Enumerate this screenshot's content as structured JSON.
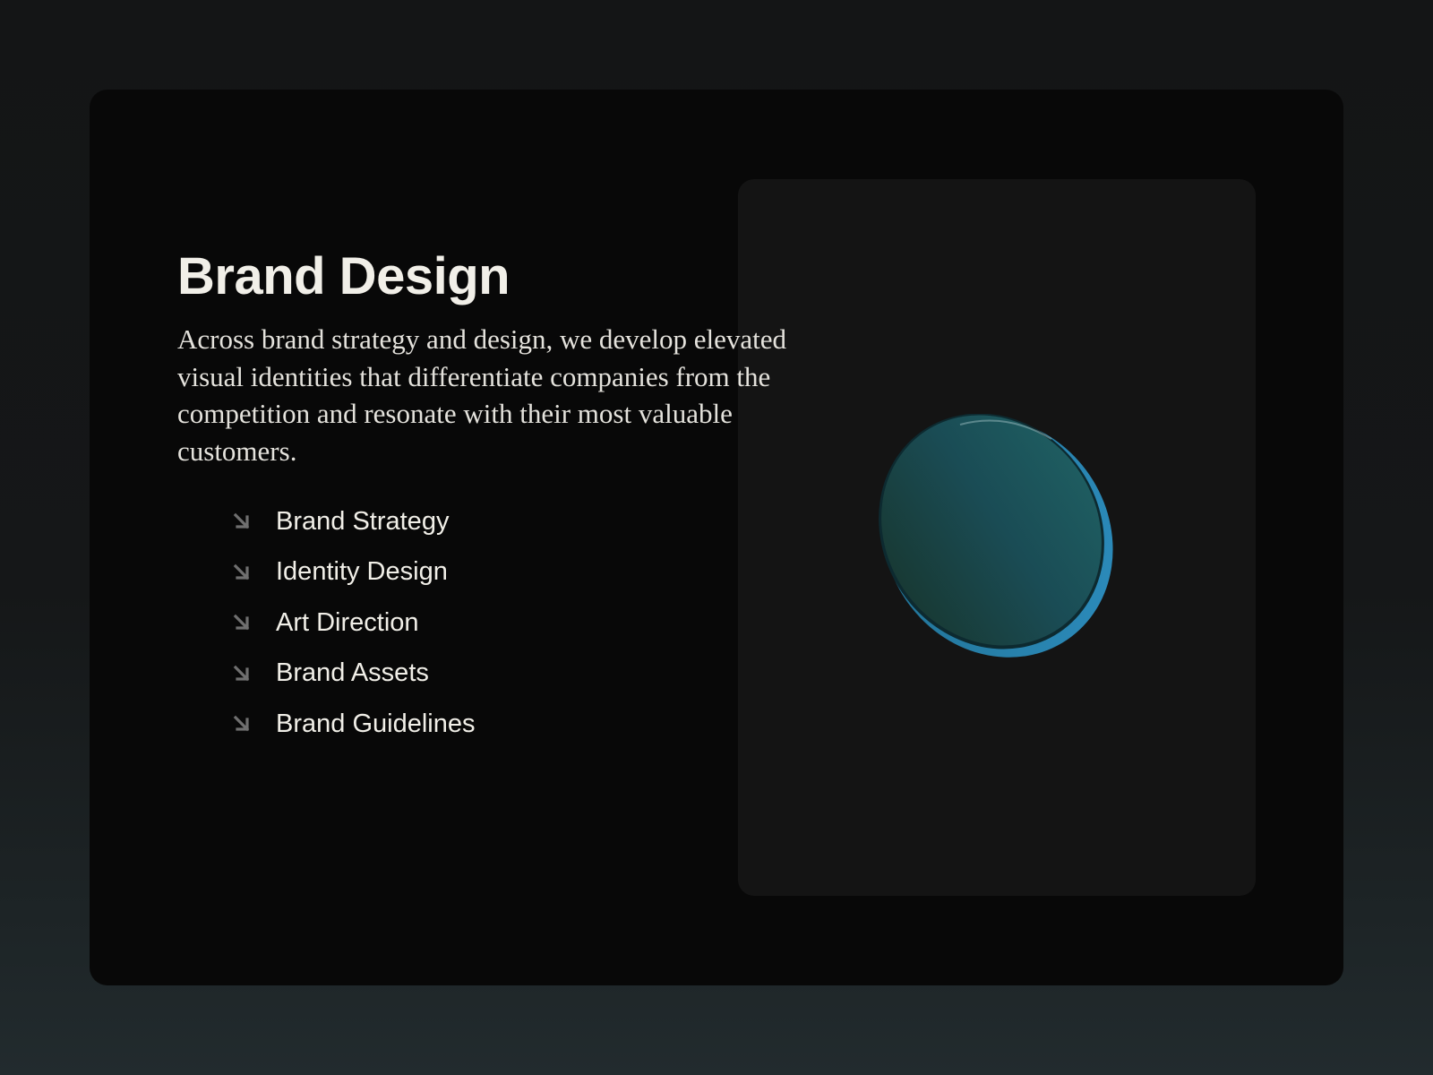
{
  "section": {
    "title": "Brand Design",
    "description": "Across brand strategy and design, we develop elevated visual identities that differentiate companies from the competition and resonate with their most valuable customers."
  },
  "services": [
    {
      "label": "Brand Strategy",
      "icon": "arrow-down-right-icon"
    },
    {
      "label": "Identity Design",
      "icon": "arrow-down-right-icon"
    },
    {
      "label": "Art Direction",
      "icon": "arrow-down-right-icon"
    },
    {
      "label": "Brand Assets",
      "icon": "arrow-down-right-icon"
    },
    {
      "label": "Brand Guidelines",
      "icon": "arrow-down-right-icon"
    }
  ],
  "media": {
    "image": "teal-glass-disc"
  },
  "colors": {
    "page_background": "#151718",
    "card_background": "#080808",
    "panel_background": "#141414",
    "text_primary": "#f1efe8",
    "arrow_icon": "#6f6f6f",
    "disc_teal": "#1d5a5e",
    "disc_edge": "#2a86b4"
  }
}
